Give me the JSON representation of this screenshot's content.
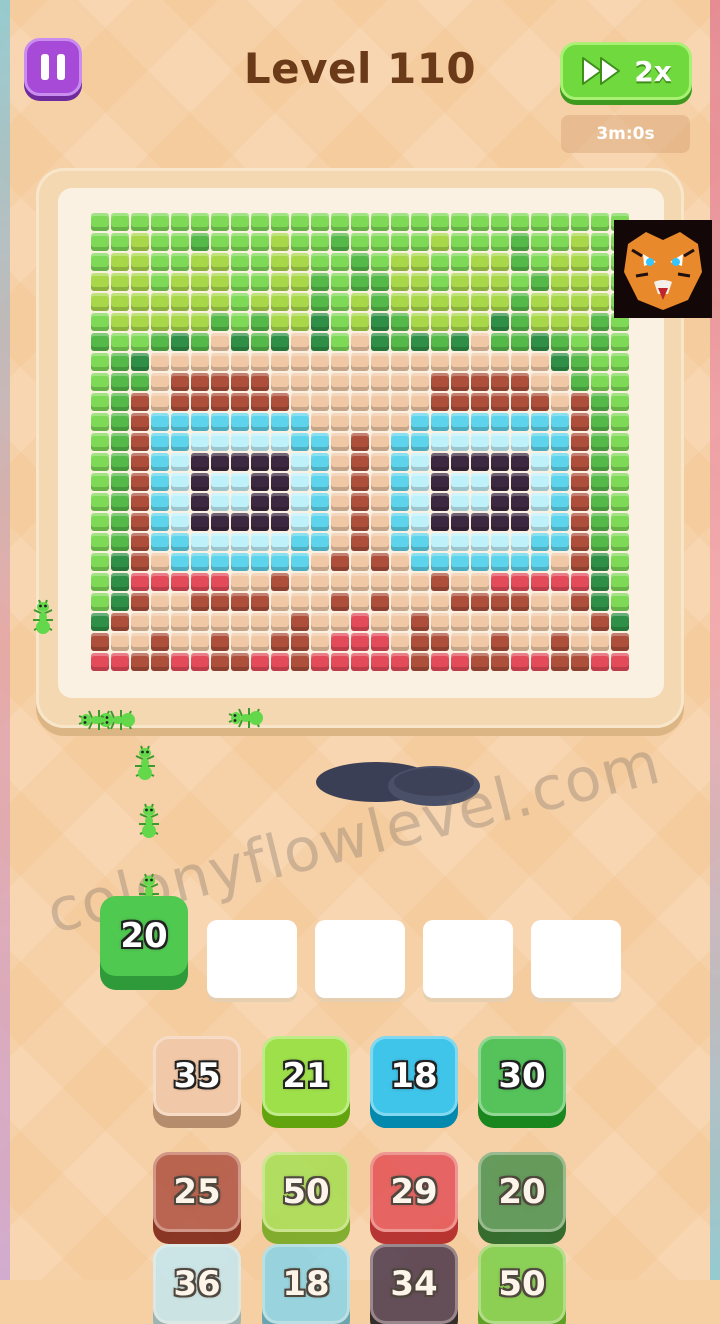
{
  "header": {
    "level_label": "Level 110",
    "speed_label": "2x",
    "timer": "3m:0s"
  },
  "watermark": "colonyflowlevel.com",
  "icons": {
    "pause": "pause-icon",
    "speed": "fast-forward-icon",
    "avatar": "tiger-icon"
  },
  "colors": {
    "P": "#a8d84a",
    "G": "#7ed957",
    "M": "#55b94a",
    "D": "#2f8f46",
    "T": "#f1c8a6",
    "B": "#ad4f3b",
    "C": "#5dd4ec",
    "L": "#bff1fb",
    "K": "#3c2840",
    "R": "#e44b5a"
  },
  "pixel_rows": [
    "GGGGGGGGGGGGGGGGGGGGGGGGGGG",
    "GGPGGMGGGPGGMGGGGPGGGMGGPGG",
    "GPPGGPPGGPPGGMGPPGGPPMGPPGG",
    "PPPGPPPGGPPMGMMPPGPPPGMPPPG",
    "PPPPPPPGPPPMGPMPPPPPPMPPPPG",
    "GPPPPPMGMPPDGPDMPPPPDMPPPMG",
    "MGGMDMTDMDTDGTDMDMDTMMDMGMG",
    "GMDTTTTTTTTTTTTTTTTTTTTDMGG",
    "GMMTBBBBBTTTTTTTTBBBBBTTMGG",
    "GMBTBBBBBBTTTTTTTBBBBBBTBMG",
    "GMBCCCCCCCCTTTTTCCCCCCCCBMG",
    "GMBCCLLLLLCCTBTCCLLLLLCCBMG",
    "GMBCLKKKKKLCTBTCLKKKKKLCBMG",
    "GMBCLKLLKKLCTBTCLKLLKKLCBMG",
    "GMBCLKLLKKLCTBTCLKLLKKLCBMG",
    "GMBCLKKKKKLCTBTCLKKKKKLCBMG",
    "GMBCCLLLLLCCTBTCCLLLLLCCBMG",
    "GDBTCCCCCCCTBTBTCCCCCCCTBDG",
    "GDRRRRRTTBTTTTTTTBTTRRRRRDG",
    "GDBTTBBBBTTTBTBTTTBBBBTTBDG",
    "DBTTTTTTTTBTTRTTBTTTTTTTTBD",
    "BTTBTTBTTBBTRRRTBBTTBTTBTTB",
    "RRBBRRBBRRBRRRRRBRRBBRRBBRR"
  ],
  "slots": {
    "held": {
      "label": "20",
      "color": "#4fc94f"
    },
    "empty_count": 5
  },
  "tiles": [
    {
      "label": "35",
      "color": "#f2c9a8"
    },
    {
      "label": "21",
      "color": "#9ee04a"
    },
    {
      "label": "18",
      "color": "#3fc4ea"
    },
    {
      "label": "30",
      "color": "#55c25a"
    },
    {
      "label": "25",
      "color": "#a9473a"
    },
    {
      "label": "50",
      "color": "#9ee04a"
    },
    {
      "label": "29",
      "color": "#e2464f"
    },
    {
      "label": "20",
      "color": "#3d8c48"
    },
    {
      "label": "36",
      "color": "#bfe9f5"
    },
    {
      "label": "18",
      "color": "#7fd6ef"
    },
    {
      "label": "34",
      "color": "#3c2a44"
    },
    {
      "label": "50",
      "color": "#6fd03e"
    }
  ]
}
